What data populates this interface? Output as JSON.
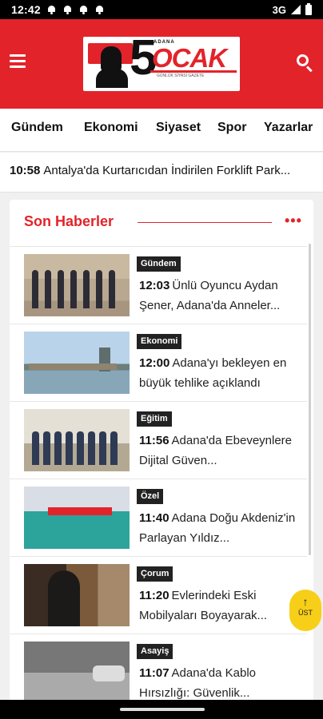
{
  "status_bar": {
    "time": "12:42",
    "network": "3G",
    "notification_icons": [
      "bell-icon",
      "bell-icon",
      "bell-icon",
      "bell-icon"
    ]
  },
  "header": {
    "menu_icon": "hamburger-icon",
    "search_icon": "search-icon",
    "logo": {
      "number": "5",
      "name": "OCAK",
      "city": "ADANA",
      "slogan": "GÜNLÜK SİYASİ GAZETE"
    },
    "brand_color": "#e3232a"
  },
  "categories": [
    "Gündem",
    "Ekonomi",
    "Siyaset",
    "Spor",
    "Yazarlar"
  ],
  "ticker": {
    "time": "10:58",
    "text": "Antalya'da Kurtarıcıdan İndirilen Forklift Park..."
  },
  "latest": {
    "title": "Son Haberler",
    "more_icon": "ellipsis-icon",
    "items": [
      {
        "category": "Gündem",
        "time": "12:03",
        "title": "Ünlü Oyuncu Aydan Şener, Adana'da Anneler..."
      },
      {
        "category": "Ekonomi",
        "time": "12:00",
        "title": "Adana'yı bekleyen en büyük tehlike açıklandı"
      },
      {
        "category": "Eğitim",
        "time": "11:56",
        "title": "Adana'da Ebeveynlere Dijital Güven..."
      },
      {
        "category": "Özel",
        "time": "11:40",
        "title": "Adana Doğu Akdeniz'in Parlayan Yıldız..."
      },
      {
        "category": "Çorum",
        "time": "11:20",
        "title": "Evlerindeki Eski Mobilyaları Boyayarak..."
      },
      {
        "category": "Asayiş",
        "time": "11:07",
        "title": "Adana'da Kablo Hırsızlığı: Güvenlik..."
      }
    ]
  },
  "scroll_top": {
    "label": "ÜST",
    "icon": "arrow-up-icon",
    "color": "#f7cf18"
  }
}
